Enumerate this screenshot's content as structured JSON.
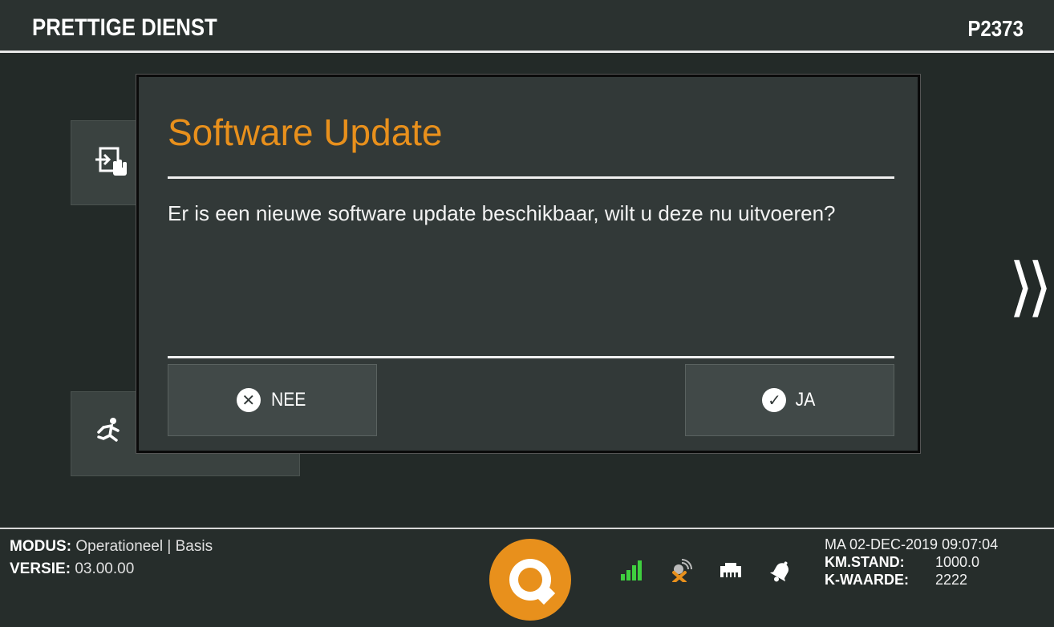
{
  "header": {
    "title": "PRETTIGE DIENST",
    "code": "P2373"
  },
  "background": {
    "tile1_icon": "login-hand-icon",
    "tile2_icon": "running-person-icon",
    "next_icon": "double-chevron-right-icon"
  },
  "dialog": {
    "title": "Software Update",
    "message": "Er is een nieuwe software update beschikbaar, wilt u deze nu uitvoeren?",
    "no_label": "NEE",
    "yes_label": "JA",
    "title_color": "#e8901c"
  },
  "footer": {
    "modus_key": "MODUS:",
    "modus_value": "Operationeel | Basis",
    "versie_key": "VERSIE:",
    "versie_value": "03.00.00",
    "datetime": "MA 02-DEC-2019 09:07:04",
    "km_key": "KM.STAND:",
    "km_value": "1000.0",
    "kw_key": "K-WAARDE:",
    "kw_value": "2222",
    "status_icons": [
      "signal-bars-icon",
      "gps-disconnected-icon",
      "network-port-icon",
      "bell-icon"
    ],
    "brand_color": "#e8901c"
  }
}
